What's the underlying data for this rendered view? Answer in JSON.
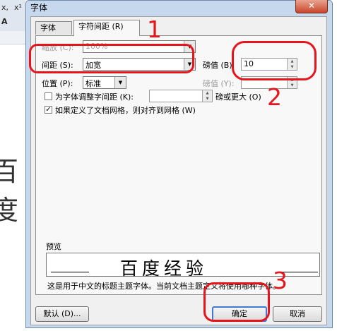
{
  "background": {
    "toolbar_items": [
      "x,",
      "x¹",
      "A"
    ],
    "doc_char": "百度"
  },
  "dialog": {
    "title": "字体",
    "close_symbol": "✕"
  },
  "tabs": [
    {
      "label": "字体 (N)"
    },
    {
      "label": "字符间距 (R)"
    }
  ],
  "spacing": {
    "scale_label": "缩放 (C):",
    "scale_value": "100%",
    "spacing_label": "间距 (S):",
    "spacing_value": "加宽",
    "spacing_by_label": "磅值 (B):",
    "spacing_by_value": "10",
    "position_label": "位置 (P):",
    "position_value": "标准",
    "position_by_label": "磅值 (Y):",
    "position_by_value": "",
    "kerning_label": "为字体调整字间距 (K):",
    "kerning_value": "",
    "kerning_suffix": "磅或更大 (O)",
    "kerning_checked": false,
    "grid_label": "如果定义了文档网格，则对齐到网格 (W)",
    "grid_checked": true
  },
  "preview": {
    "label": "预览",
    "sample": "百度经验",
    "note": "这是用于中文的标题主题字体。当前文档主题定义将使用哪种字体。"
  },
  "buttons": {
    "default_label": "默认 (D)...",
    "ok_label": "确定",
    "cancel_label": "取消"
  },
  "annotations": [
    "1",
    "2",
    "3"
  ],
  "colors": {
    "annotation": "#e8141b",
    "dialog_frame": "#c6d8ee",
    "default_button_border": "#3a7bd5"
  }
}
